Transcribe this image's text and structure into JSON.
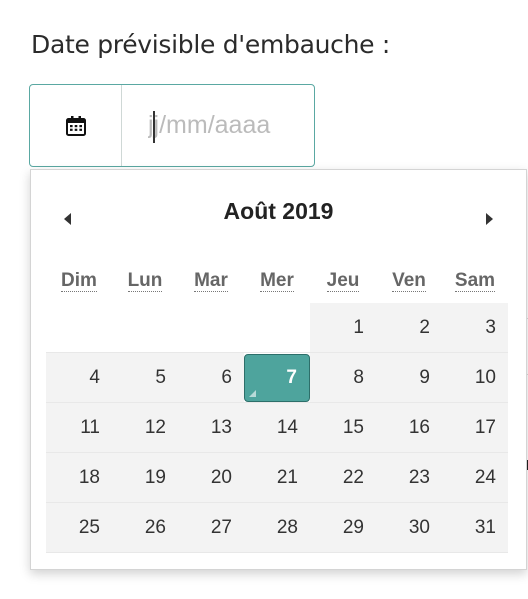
{
  "form": {
    "label": "Date prévisible d'embauche :",
    "input_value": "",
    "input_placeholder": "jj/mm/aaaa",
    "addon_icon": "calendar-icon"
  },
  "datepicker": {
    "title": "Août 2019",
    "prev_icon": "triangle-left-icon",
    "next_icon": "triangle-right-icon",
    "weekdays": [
      "Dim",
      "Lun",
      "Mar",
      "Mer",
      "Jeu",
      "Ven",
      "Sam"
    ],
    "weeks": [
      [
        "",
        "",
        "",
        "",
        "1",
        "2",
        "3"
      ],
      [
        "4",
        "5",
        "6",
        "7",
        "8",
        "9",
        "10"
      ],
      [
        "11",
        "12",
        "13",
        "14",
        "15",
        "16",
        "17"
      ],
      [
        "18",
        "19",
        "20",
        "21",
        "22",
        "23",
        "24"
      ],
      [
        "25",
        "26",
        "27",
        "28",
        "29",
        "30",
        "31"
      ]
    ],
    "selected_day": "7",
    "accent_color": "#4ea49d"
  }
}
